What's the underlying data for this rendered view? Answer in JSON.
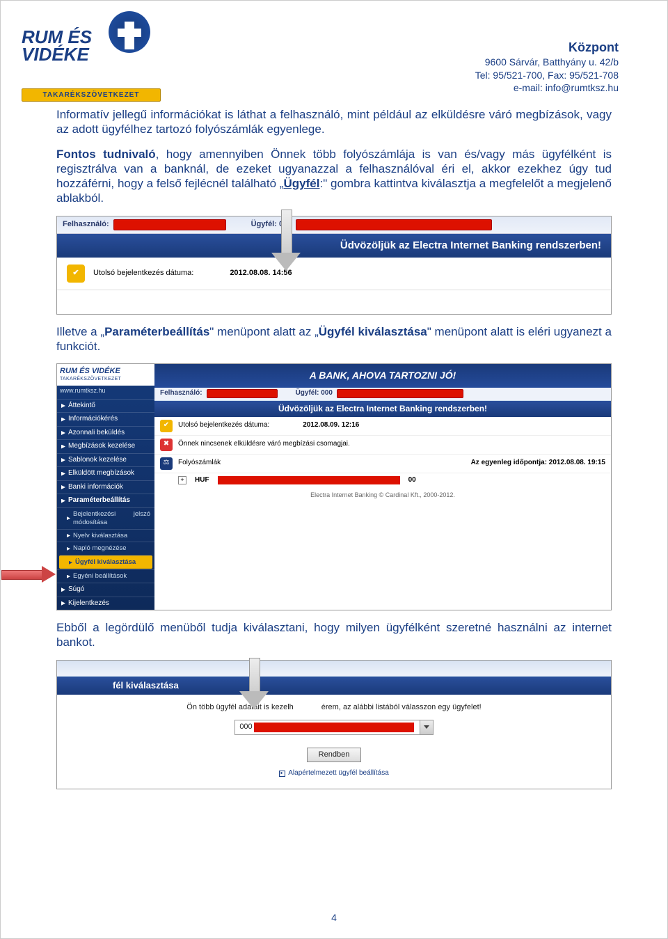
{
  "header": {
    "logo_line1": "RUM ÉS",
    "logo_line2": "VIDÉKE",
    "logo_banner": "TAKARÉKSZÖVETKEZET",
    "contact_title": "Központ",
    "contact_addr": "9600 Sárvár, Batthyány u. 42/b",
    "contact_tel": "Tel: 95/521-700, Fax: 95/521-708",
    "contact_email": "e-mail: info@rumtksz.hu"
  },
  "para1": "Informatív jellegű információkat is láthat a felhasználó, mint például az elküldésre váró megbízások, vagy az adott ügyfélhez tartozó folyószámlák egyenlege.",
  "para2a": "Fontos tudnivaló",
  "para2b": ", hogy amennyiben Önnek több folyószámlája is van és/vagy más ügyfélként is regisztrálva van a banknál, de ezeket ugyanazzal a felhasználóval éri el, akkor ezekhez úgy tud hozzáférni, hogy a felső fejlécnél található „",
  "para2c": "Ügyfél",
  "para2d": ":\" gombra kattintva kiválasztja a megfelelőt a megjelenő ablakból.",
  "shot1": {
    "user_label": "Felhasználó:",
    "client_label": "Ügyfél: 000",
    "welcome": "Üdvözöljük az Electra Internet Banking rendszerben!",
    "lastlogin_label": "Utolsó bejelentkezés dátuma:",
    "lastlogin_value": "2012.08.08. 14:56"
  },
  "para3a": "Illetve a „",
  "para3b": "Paraméterbeállítás",
  "para3c": "\" menüpont alatt az „",
  "para3d": "Ügyfél kiválasztása",
  "para3e": "\" menüpont alatt is eléri ugyanezt a funkciót.",
  "shot2": {
    "logo": "RUM ÉS VIDÉKE",
    "logo_sub": "TAKARÉKSZÖVETKEZET",
    "url": "www.rumtksz.hu",
    "slogan": "A BANK, AHOVA TARTOZNI JÓ!",
    "user_label": "Felhasználó:",
    "client_label": "Ügyfél: 000",
    "welcome": "Üdvözöljük az Electra Internet Banking rendszerben!",
    "lastlogin_label": "Utolsó bejelentkezés dátuma:",
    "lastlogin_value": "2012.08.09. 12:16",
    "nopending": "Önnek nincsenek elküldésre váró megbízási csomagjai.",
    "acct_label": "Folyószámlák",
    "balance_head": "Az egyenleg időpontja: 2012.08.08. 19:15",
    "currency": "HUF",
    "balance_end": "00",
    "footer": "Electra Internet Banking © Cardinal Kft., 2000-2012.",
    "menu": [
      "Áttekintő",
      "Információkérés",
      "Azonnali beküldés",
      "Megbízások kezelése",
      "Sablonok kezelése",
      "Elküldött megbízások",
      "Banki információk",
      "Paraméterbeállítás"
    ],
    "submenu": [
      "Bejelentkezési jelszó módosítása",
      "Nyelv kiválasztása",
      "Napló megnézése",
      "Ügyfél kiválasztása",
      "Egyéni beállítások"
    ],
    "menu_tail": [
      "Súgó",
      "Kijelentkezés"
    ]
  },
  "para4": "Ebből a legördülő menüből tudja kiválasztani, hogy milyen ügyfélként szeretné használni az internet bankot.",
  "shot3": {
    "title": "fél kiválasztása",
    "instr_a": "Ön több ügyfél adatait is kezelh",
    "instr_b": "érem, az alábbi listából válasszon egy ügyfelet!",
    "sel_prefix": "000",
    "ok": "Rendben",
    "link": "Alapértelmezett ügyfél beállítása"
  },
  "page_number": "4"
}
